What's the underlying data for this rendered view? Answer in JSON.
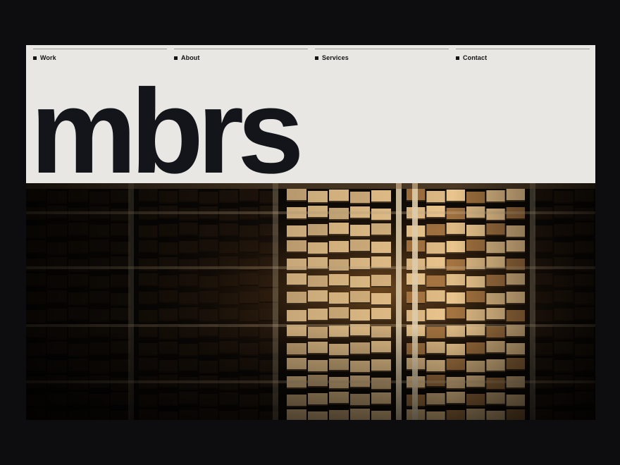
{
  "nav": {
    "items": [
      {
        "label": "Work"
      },
      {
        "label": "About"
      },
      {
        "label": "Services"
      },
      {
        "label": "Contact"
      }
    ]
  },
  "brand": {
    "name": "mbrs"
  },
  "hero": {
    "subject": "stacked lumber drying racks in a dim warehouse"
  },
  "colors": {
    "page_bg": "#0d0d0f",
    "frame_bg": "#e8e7e3",
    "text": "#14151a",
    "wood_light": "#e9c48c",
    "wood_mid": "#b8834a",
    "wood_dark": "#3a2614"
  }
}
